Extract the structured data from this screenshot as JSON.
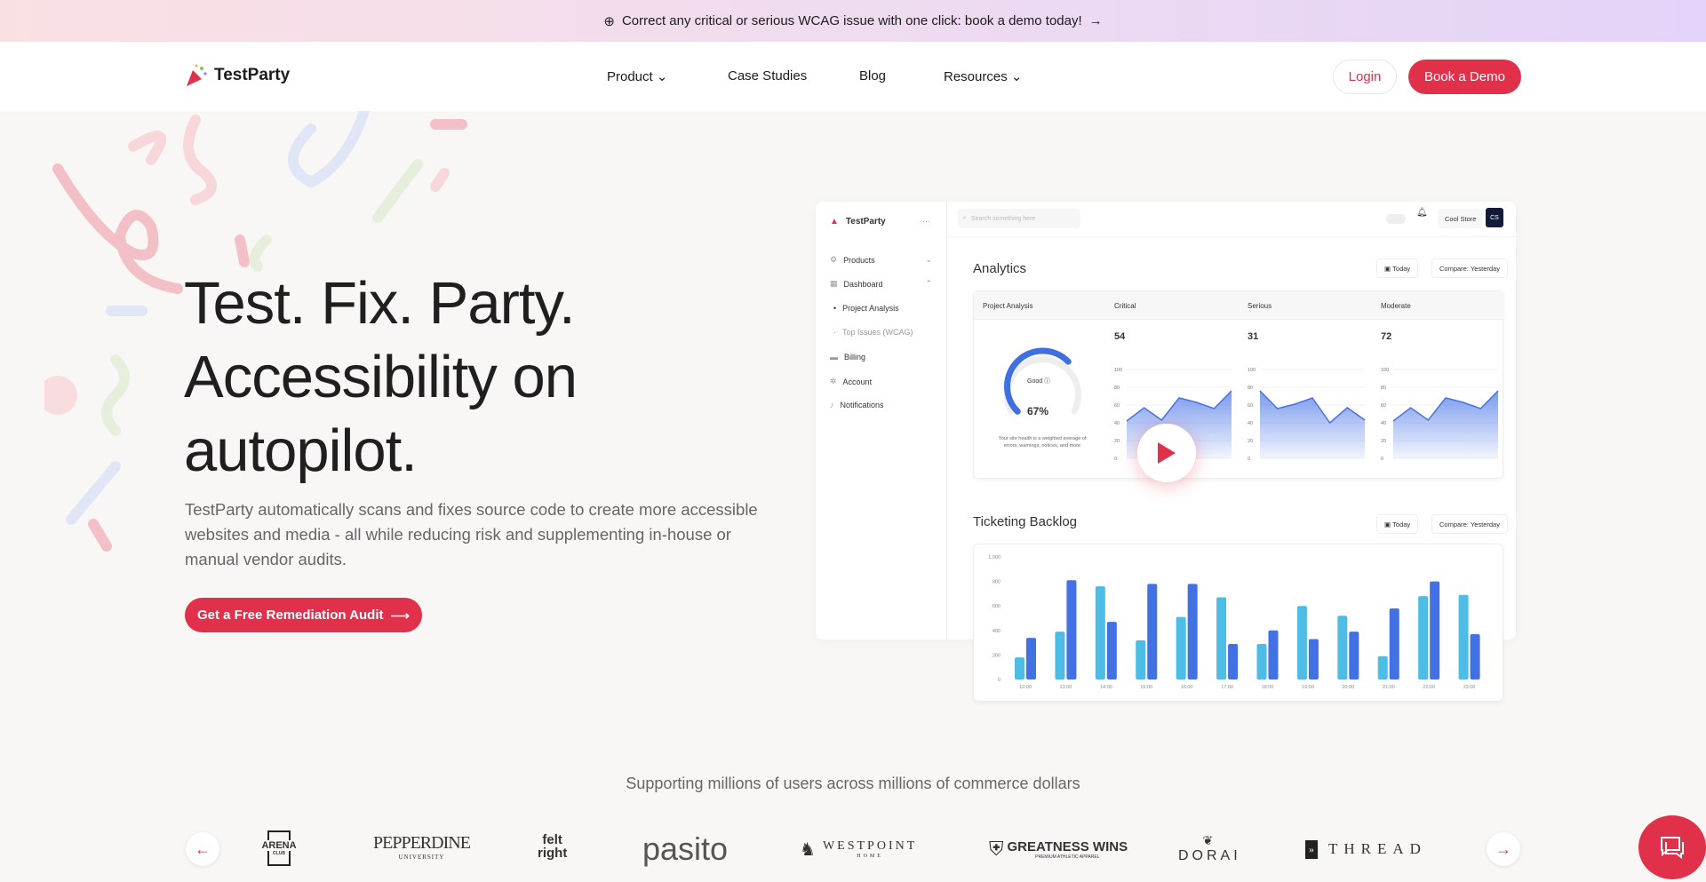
{
  "banner": {
    "text": "Correct any critical or serious WCAG issue with one click: book a demo today!",
    "arrow": "→"
  },
  "nav": {
    "brand": "TestParty",
    "items": [
      "Product",
      "Case Studies",
      "Blog",
      "Resources"
    ],
    "login": "Login",
    "demo": "Book a Demo"
  },
  "hero": {
    "line1": "Test. Fix. Party.",
    "line2": "Accessibility on",
    "line3": "autopilot.",
    "lead": "TestParty automatically scans and fixes source code to create more accessible websites and media - all while reducing risk and supplementing in-house or manual vendor audits.",
    "cta": "Get a Free Remediation Audit",
    "cta_arrow": "⟶"
  },
  "dashboard": {
    "brand": "TestParty",
    "menu_dots": "···",
    "search_placeholder": "Search something here",
    "store": "Cool Store",
    "avatar": "CS",
    "sidebar": [
      {
        "label": "Products",
        "chev": "⌄"
      },
      {
        "label": "Dashboard",
        "chev": "⌃"
      },
      {
        "label": "Project Analysis"
      },
      {
        "label": "Top Issues (WCAG)"
      },
      {
        "label": "Billing"
      },
      {
        "label": "Account"
      },
      {
        "label": "Notifications"
      }
    ],
    "analytics_title": "Analytics",
    "today": "Today",
    "compare": "Compare: Yesterday",
    "columns": [
      "Project Analysis",
      "Critical",
      "Serious",
      "Moderate"
    ],
    "gauge": {
      "label": "Good",
      "value_text": "67%",
      "value": 0.67,
      "note": "Your site health is a weighted average of errors, warnings, notices, and more"
    },
    "yticks": [
      "100",
      "80",
      "60",
      "40",
      "20",
      "0"
    ],
    "metrics": [
      {
        "value": "54",
        "series": [
          42,
          57,
          43,
          68,
          63,
          56,
          76
        ]
      },
      {
        "value": "31",
        "series": [
          76,
          56,
          61,
          68,
          40,
          57,
          43
        ]
      },
      {
        "value": "72",
        "series": [
          42,
          57,
          43,
          68,
          63,
          56,
          76
        ]
      }
    ],
    "backlog_title": "Ticketing Backlog"
  },
  "chart_data": {
    "type": "bar",
    "title": "Ticketing Backlog",
    "categories": [
      "12:00",
      "13:00",
      "14:00",
      "15:00",
      "16:00",
      "17:00",
      "18:00",
      "19:00",
      "20:00",
      "21:00",
      "22:00",
      "23:00"
    ],
    "ylim": [
      0,
      1000
    ],
    "yticks": [
      "1,000",
      "800",
      "600",
      "400",
      "200",
      "0"
    ],
    "series": [
      {
        "name": "Today",
        "color": "#4dbde6",
        "values": [
          180,
          390,
          760,
          320,
          510,
          670,
          290,
          600,
          520,
          190,
          680,
          690
        ]
      },
      {
        "name": "Yesterday",
        "color": "#4271e3",
        "values": [
          340,
          810,
          470,
          780,
          780,
          290,
          400,
          330,
          390,
          580,
          800,
          370
        ]
      }
    ]
  },
  "clients": {
    "heading": "Supporting millions of users across millions of commerce dollars",
    "logos": [
      "ARENA",
      "CLUB",
      "PEPPERDINE",
      "UNIVERSITY",
      "felt",
      "right",
      "pasito",
      "WESTPOINT",
      "HOME",
      "GREATNESS WINS",
      "PREMIUM ATHLETIC APPAREL",
      "DORAI",
      "THREAD"
    ],
    "prev": "←",
    "next": "→"
  }
}
